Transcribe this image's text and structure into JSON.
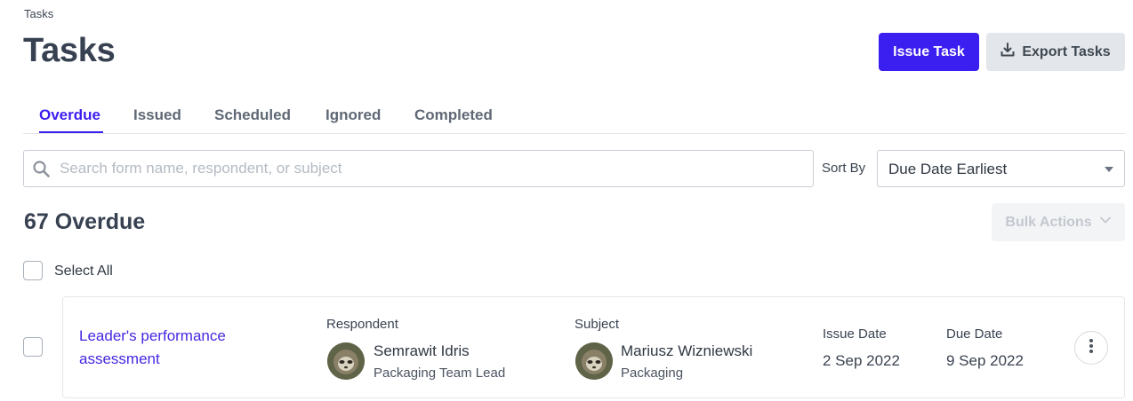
{
  "breadcrumb": "Tasks",
  "page_title": "Tasks",
  "header_buttons": {
    "issue_task": "Issue Task",
    "export_tasks": "Export Tasks",
    "export_icon": "download-icon"
  },
  "tabs": [
    {
      "label": "Overdue",
      "active": true
    },
    {
      "label": "Issued",
      "active": false
    },
    {
      "label": "Scheduled",
      "active": false
    },
    {
      "label": "Ignored",
      "active": false
    },
    {
      "label": "Completed",
      "active": false
    }
  ],
  "search": {
    "placeholder": "Search form name, respondent, or subject",
    "value": "",
    "icon": "search-icon"
  },
  "sort": {
    "label": "Sort By",
    "selected": "Due Date Earliest"
  },
  "summary": {
    "count_label": "67 Overdue"
  },
  "bulk_actions": {
    "label": "Bulk Actions",
    "enabled": false
  },
  "select_all": {
    "label": "Select All",
    "checked": false
  },
  "tasks": [
    {
      "title": "Leader's performance assessment",
      "checked": false,
      "respondent_heading": "Respondent",
      "respondent_name": "Semrawit Idris",
      "respondent_role": "Packaging Team Lead",
      "subject_heading": "Subject",
      "subject_name": "Mariusz Wizniewski",
      "subject_dept": "Packaging",
      "issue_date_heading": "Issue Date",
      "issue_date": "2 Sep 2022",
      "due_date_heading": "Due Date",
      "due_date": "9 Sep 2022"
    }
  ],
  "colors": {
    "accent": "#3b1ef0",
    "link": "#4628e0",
    "secondary_button": "#e3e6ea",
    "disabled_button": "#f3f4f6"
  }
}
